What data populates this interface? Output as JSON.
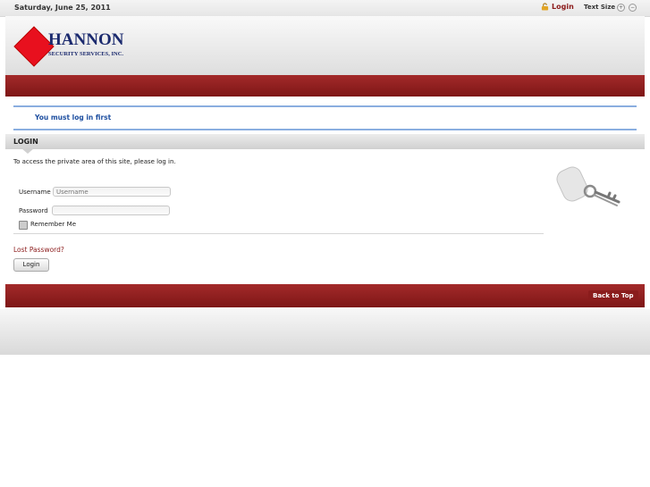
{
  "topbar": {
    "date": "Saturday, June 25, 2011",
    "login_label": "Login",
    "text_size_label": "Text Size",
    "text_size_increase": "+",
    "text_size_decrease": "−"
  },
  "logo": {
    "name": "HANNON",
    "tagline": "SECURITY SERVICES, INC."
  },
  "message": "You must log in first",
  "login_section": {
    "heading": "LOGIN",
    "intro": "To access the private area of this site, please log in.",
    "username_label": "Username",
    "username_placeholder": "Username",
    "password_label": "Password",
    "remember_label": "Remember Me",
    "lost_password": "Lost Password?",
    "submit_label": "Login"
  },
  "footer": {
    "back_to_top": "Back to Top"
  },
  "colors": {
    "brand_red": "#8b1a1a",
    "message_blue": "#1e4fa0",
    "logo_diamond": "#e8101e"
  }
}
